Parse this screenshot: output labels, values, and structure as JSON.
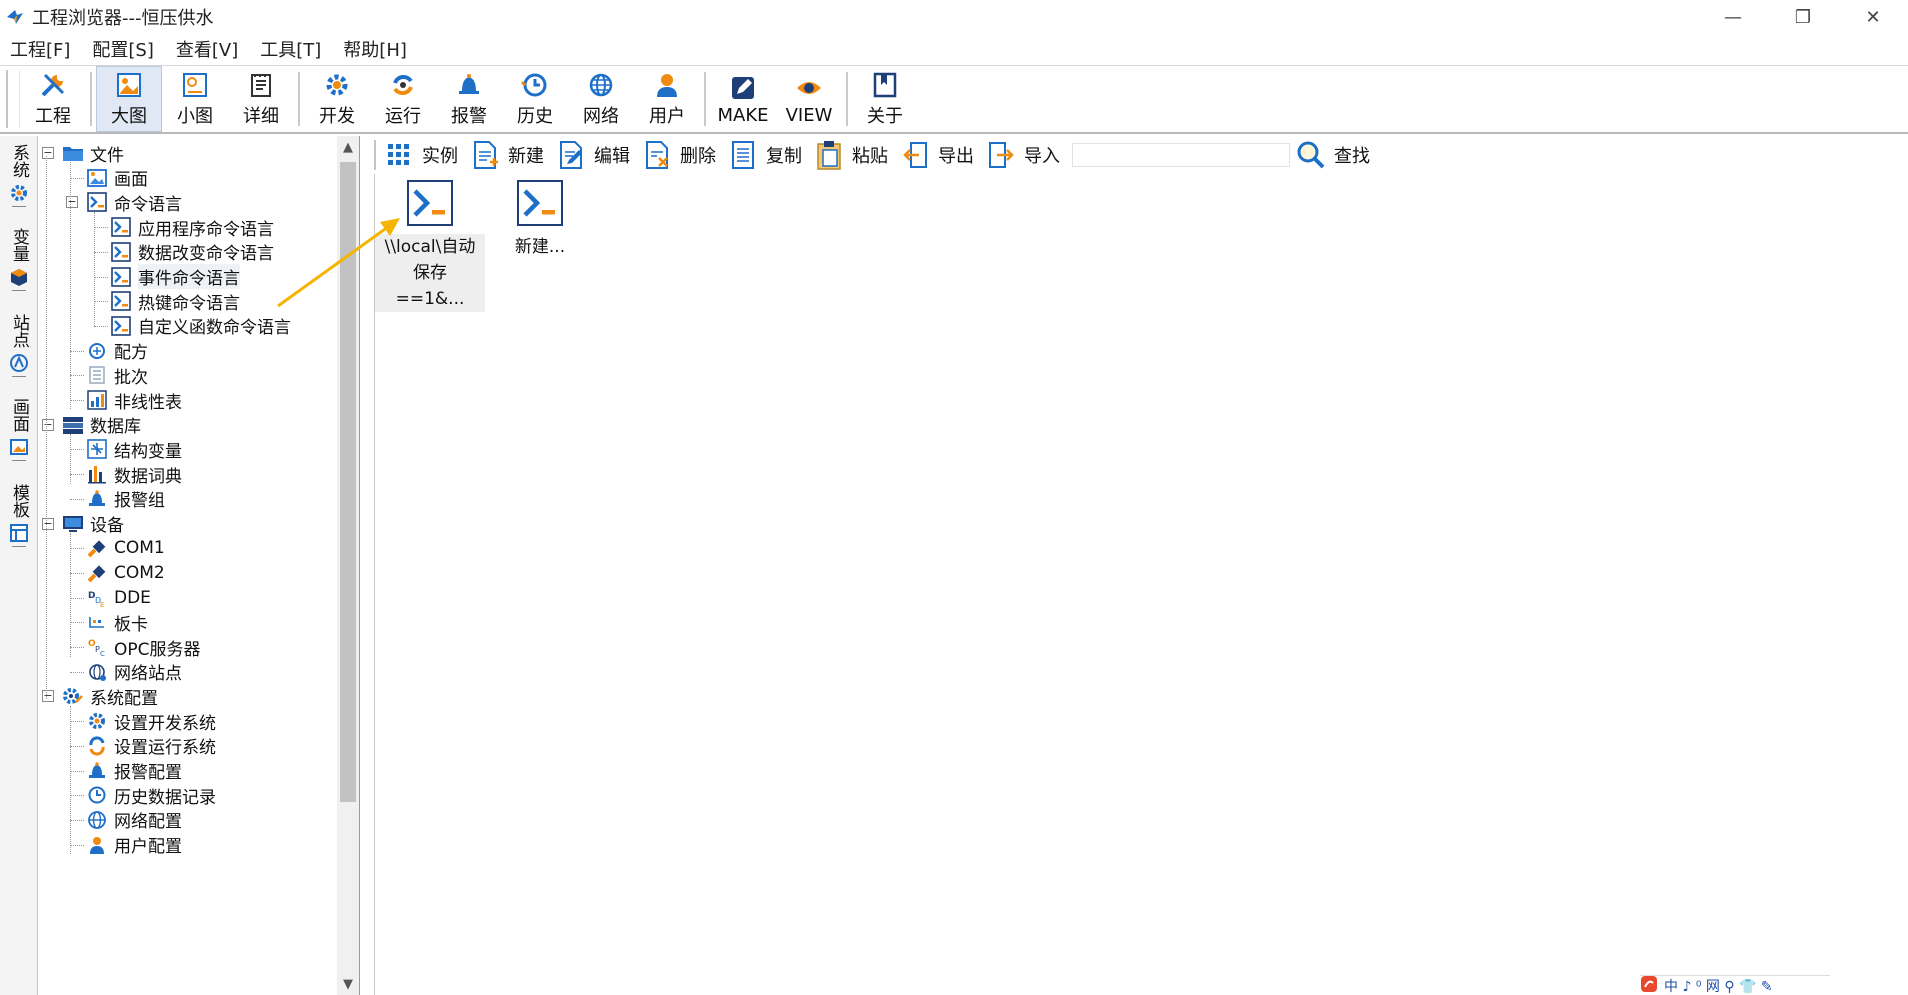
{
  "window": {
    "title": "工程浏览器---恒压供水",
    "minimize_glyph": "—",
    "restore_glyph": "❐",
    "close_glyph": "✕"
  },
  "menu": [
    "工程[F]",
    "配置[S]",
    "查看[V]",
    "工具[T]",
    "帮助[H]"
  ],
  "toolbar": {
    "groups": [
      [
        {
          "label": "工程",
          "icon": "wrench-icon"
        }
      ],
      [
        {
          "label": "大图",
          "icon": "large-icons-icon",
          "active": true
        },
        {
          "label": "小图",
          "icon": "small-icons-icon"
        },
        {
          "label": "详细",
          "icon": "details-icon"
        }
      ],
      [
        {
          "label": "开发",
          "icon": "develop-gear-icon"
        },
        {
          "label": "运行",
          "icon": "run-icon"
        },
        {
          "label": "报警",
          "icon": "alarm-bell-icon"
        },
        {
          "label": "历史",
          "icon": "history-clock-icon"
        },
        {
          "label": "网络",
          "icon": "network-globe-icon"
        },
        {
          "label": "用户",
          "icon": "user-icon"
        }
      ],
      [
        {
          "label": "MAKE",
          "icon": "make-edit-icon"
        },
        {
          "label": "VIEW",
          "icon": "view-eye-icon"
        }
      ],
      [
        {
          "label": "关于",
          "icon": "about-book-icon"
        }
      ]
    ]
  },
  "side_tabs": [
    "系统",
    "变量",
    "站点",
    "画面",
    "模板"
  ],
  "tree": [
    {
      "label": "文件",
      "level": 0,
      "icon": "folder-icon",
      "expander": "−"
    },
    {
      "label": "画面",
      "level": 1,
      "icon": "picture-icon"
    },
    {
      "label": "命令语言",
      "level": 1,
      "icon": "command-icon",
      "expander": "−"
    },
    {
      "label": "应用程序命令语言",
      "level": 2,
      "icon": "command-icon"
    },
    {
      "label": "数据改变命令语言",
      "level": 2,
      "icon": "command-icon"
    },
    {
      "label": "事件命令语言",
      "level": 2,
      "icon": "command-icon",
      "highlight": true
    },
    {
      "label": "热键命令语言",
      "level": 2,
      "icon": "command-icon"
    },
    {
      "label": "自定义函数命令语言",
      "level": 2,
      "icon": "command-icon"
    },
    {
      "label": "配方",
      "level": 1,
      "icon": "recipe-icon"
    },
    {
      "label": "批次",
      "level": 1,
      "icon": "batch-icon"
    },
    {
      "label": "非线性表",
      "level": 1,
      "icon": "nonlinear-chart-icon"
    },
    {
      "label": "数据库",
      "level": 0,
      "icon": "database-icon",
      "expander": "−"
    },
    {
      "label": "结构变量",
      "level": 1,
      "icon": "struct-variable-icon"
    },
    {
      "label": "数据词典",
      "level": 1,
      "icon": "data-dictionary-icon"
    },
    {
      "label": "报警组",
      "level": 1,
      "icon": "alarm-bell-icon"
    },
    {
      "label": "设备",
      "level": 0,
      "icon": "monitor-icon",
      "expander": "−"
    },
    {
      "label": "COM1",
      "level": 1,
      "icon": "serial-port-icon"
    },
    {
      "label": "COM2",
      "level": 1,
      "icon": "serial-port-icon"
    },
    {
      "label": "DDE",
      "level": 1,
      "icon": "dde-icon"
    },
    {
      "label": "板卡",
      "level": 1,
      "icon": "board-card-icon"
    },
    {
      "label": "OPC服务器",
      "level": 1,
      "icon": "opc-icon"
    },
    {
      "label": "网络站点",
      "level": 1,
      "icon": "network-site-icon"
    },
    {
      "label": "系统配置",
      "level": 0,
      "icon": "system-config-icon",
      "expander": "−"
    },
    {
      "label": "设置开发系统",
      "level": 1,
      "icon": "develop-gear-icon"
    },
    {
      "label": "设置运行系统",
      "level": 1,
      "icon": "run-icon"
    },
    {
      "label": "报警配置",
      "level": 1,
      "icon": "alarm-bell-icon"
    },
    {
      "label": "历史数据记录",
      "level": 1,
      "icon": "history-clock-icon"
    },
    {
      "label": "网络配置",
      "level": 1,
      "icon": "network-globe-icon"
    },
    {
      "label": "用户配置",
      "level": 1,
      "icon": "user-icon"
    }
  ],
  "content_toolbar": {
    "buttons": [
      {
        "label": "实例",
        "icon": "instance-grid-icon"
      },
      {
        "label": "新建",
        "icon": "new-doc-icon"
      },
      {
        "label": "编辑",
        "icon": "edit-doc-icon"
      },
      {
        "label": "删除",
        "icon": "delete-doc-icon"
      },
      {
        "label": "复制",
        "icon": "copy-doc-icon"
      },
      {
        "label": "粘贴",
        "icon": "paste-icon"
      },
      {
        "label": "导出",
        "icon": "export-arrow-icon"
      },
      {
        "label": "导入",
        "icon": "import-arrow-icon"
      }
    ],
    "search_value": "",
    "find_label": "查找"
  },
  "files": [
    {
      "lines": [
        "\\\\local\\自动",
        "保存==1&..."
      ],
      "selected": true
    },
    {
      "lines": [
        "新建..."
      ],
      "selected": false
    }
  ],
  "ime_tray": "中 ♪ ⁰ 网 ⚲ 👕 ✎"
}
